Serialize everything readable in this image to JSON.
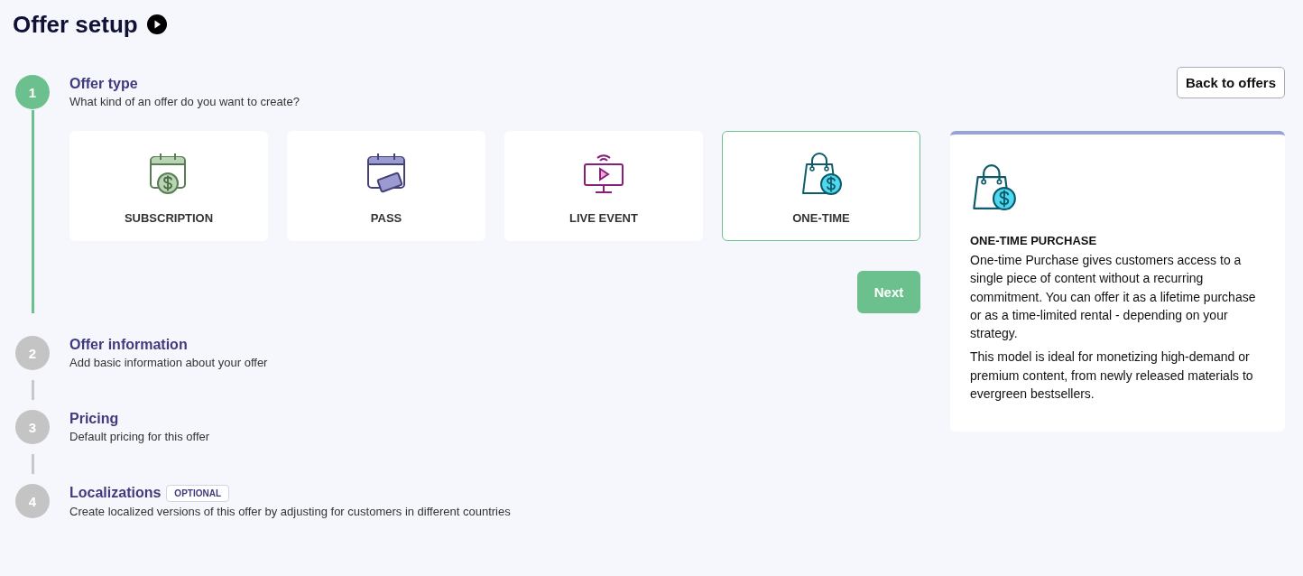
{
  "page": {
    "title": "Offer setup"
  },
  "back_button": "Back to offers",
  "steps": [
    {
      "number": "1",
      "title": "Offer type",
      "subtitle": "What kind of an offer do you want to create?",
      "active": true
    },
    {
      "number": "2",
      "title": "Offer information",
      "subtitle": "Add basic information about your offer",
      "active": false
    },
    {
      "number": "3",
      "title": "Pricing",
      "subtitle": "Default pricing for this offer",
      "active": false
    },
    {
      "number": "4",
      "title": "Localizations",
      "badge": "OPTIONAL",
      "subtitle": "Create localized versions of this offer by adjusting for customers in different countries",
      "active": false
    }
  ],
  "offer_types": [
    {
      "kind": "subscription",
      "label": "SUBSCRIPTION",
      "selected": false
    },
    {
      "kind": "pass",
      "label": "PASS",
      "selected": false
    },
    {
      "kind": "live",
      "label": "LIVE EVENT",
      "selected": false
    },
    {
      "kind": "onetime",
      "label": "ONE-TIME",
      "selected": true
    }
  ],
  "next_button": "Next",
  "info_panel": {
    "kind": "onetime",
    "title": "ONE-TIME PURCHASE",
    "paragraphs": [
      "One-time Purchase gives customers access to a single piece of content without a recurring commitment. You can offer it as a lifetime purchase or as a time-limited rental - depending on your strategy.",
      "This model is ideal for monetizing high-demand or premium content, from newly released materials to evergreen bestsellers."
    ]
  }
}
